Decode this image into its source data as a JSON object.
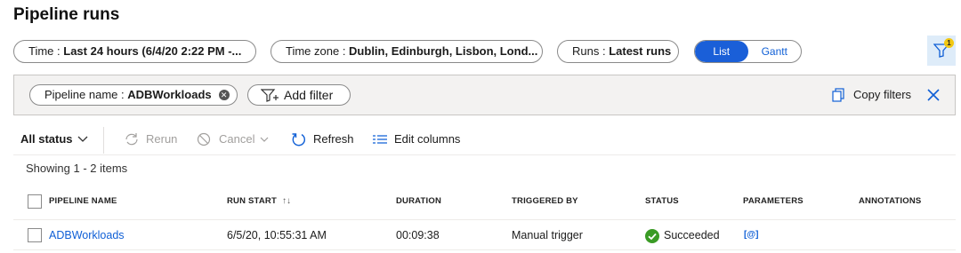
{
  "page": {
    "title": "Pipeline runs"
  },
  "filters": {
    "time_label": "Time : ",
    "time_value": "Last 24 hours (6/4/20 2:22 PM -...",
    "timezone_label": "Time zone : ",
    "timezone_value": "Dublin, Edinburgh, Lisbon, Lond...",
    "runs_label": "Runs : ",
    "runs_value": "Latest runs",
    "view_list": "List",
    "view_gantt": "Gantt",
    "active_filter_count": "1"
  },
  "filter_bar": {
    "chip_label": "Pipeline name : ",
    "chip_value": "ADBWorkloads",
    "add_filter": "Add filter",
    "copy_filters": "Copy filters"
  },
  "toolbar": {
    "all_status": "All status",
    "rerun": "Rerun",
    "cancel": "Cancel",
    "refresh": "Refresh",
    "edit_columns": "Edit columns"
  },
  "summary": "Showing 1 - 2 items",
  "table": {
    "columns": [
      "PIPELINE NAME",
      "RUN START",
      "DURATION",
      "TRIGGERED BY",
      "STATUS",
      "PARAMETERS",
      "ANNOTATIONS"
    ],
    "rows": [
      {
        "pipeline_name": "ADBWorkloads",
        "run_start": "6/5/20, 10:55:31 AM",
        "duration": "00:09:38",
        "triggered_by": "Manual trigger",
        "status": "Succeeded",
        "parameters": "[@]",
        "annotations": ""
      }
    ]
  },
  "colors": {
    "accent": "#1a5fd8",
    "success": "#3a9b25",
    "badge": "#f2c811",
    "filter_bar_bg": "#f3f2f1"
  },
  "icons": [
    "filter-icon",
    "close-icon",
    "add-filter-icon",
    "copy-icon",
    "chevron-down-icon",
    "rerun-icon",
    "cancel-icon",
    "refresh-icon",
    "edit-columns-icon",
    "sort-icon",
    "success-icon"
  ]
}
